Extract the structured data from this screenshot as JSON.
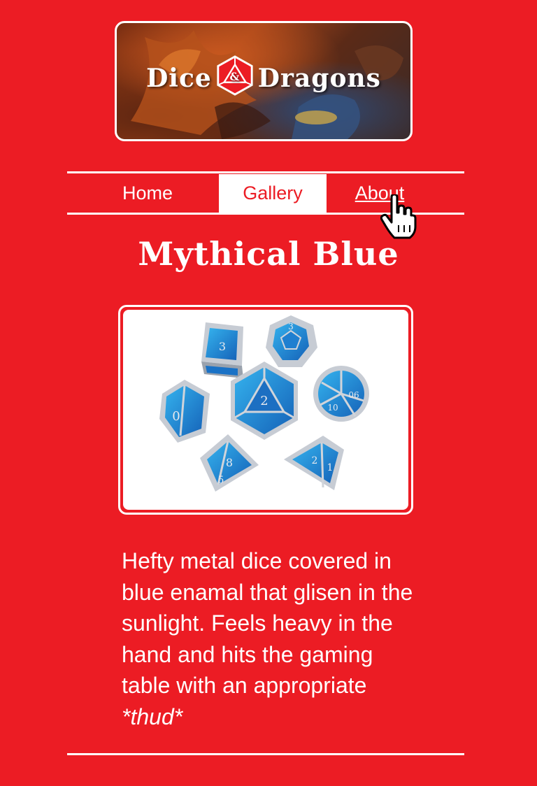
{
  "brand": {
    "name_left": "Dice",
    "name_right": "Dragons",
    "ampersand": "&"
  },
  "nav": {
    "items": [
      {
        "label": "Home"
      },
      {
        "label": "Gallery",
        "active": true
      },
      {
        "label": "About",
        "hovered": true
      }
    ]
  },
  "page": {
    "title": "Mythical Blue",
    "description": "Hefty metal dice covered in blue enamal that glisen in the sunlight. Feels heavy in the hand and hits the gaming table with an appropriate ",
    "description_emphasis": "*thud*"
  },
  "colors": {
    "background": "#ec1c24",
    "text": "#ffffff",
    "dice_blue": "#1e90d6",
    "dice_silver": "#c7ccd4"
  },
  "icons": {
    "logo": "d20-icon",
    "cursor": "hand-pointer-icon"
  }
}
